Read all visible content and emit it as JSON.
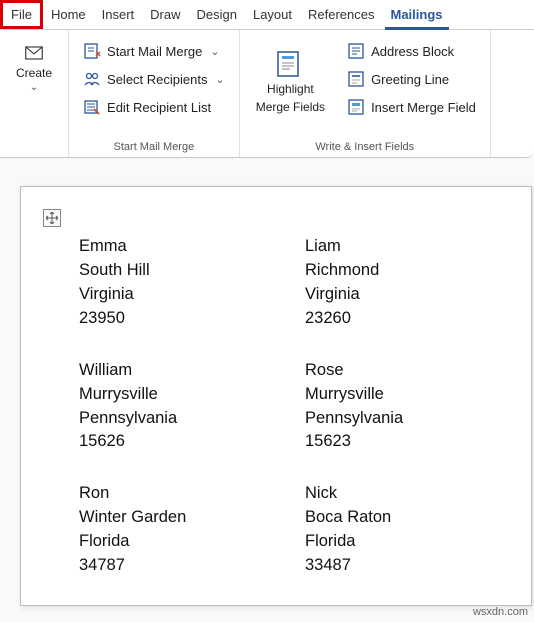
{
  "tabs": {
    "file": "File",
    "home": "Home",
    "insert": "Insert",
    "draw": "Draw",
    "design": "Design",
    "layout": "Layout",
    "references": "References",
    "mailings": "Mailings"
  },
  "ribbon": {
    "create": {
      "label": "Create"
    },
    "mailmerge": {
      "group_label": "Start Mail Merge",
      "start": "Start Mail Merge",
      "select": "Select Recipients",
      "edit": "Edit Recipient List"
    },
    "highlight": {
      "label_top": "Highlight",
      "label_bottom": "Merge Fields"
    },
    "write": {
      "group_label": "Write & Insert Fields",
      "address": "Address Block",
      "greeting": "Greeting Line",
      "insert": "Insert Merge Field"
    }
  },
  "labels": [
    {
      "name": "Emma",
      "city": "South Hill",
      "state": "Virginia",
      "zip": "23950"
    },
    {
      "name": "Liam",
      "city": "Richmond",
      "state": "Virginia",
      "zip": "23260"
    },
    {
      "name": "William",
      "city": "Murrysville",
      "state": "Pennsylvania",
      "zip": "15626"
    },
    {
      "name": "Rose",
      "city": "Murrysville",
      "state": "Pennsylvania",
      "zip": "15623"
    },
    {
      "name": "Ron",
      "city": "Winter Garden",
      "state": "Florida",
      "zip": "34787"
    },
    {
      "name": "Nick",
      "city": "Boca Raton",
      "state": "Florida",
      "zip": "33487"
    }
  ],
  "watermark": "wsxdn.com"
}
